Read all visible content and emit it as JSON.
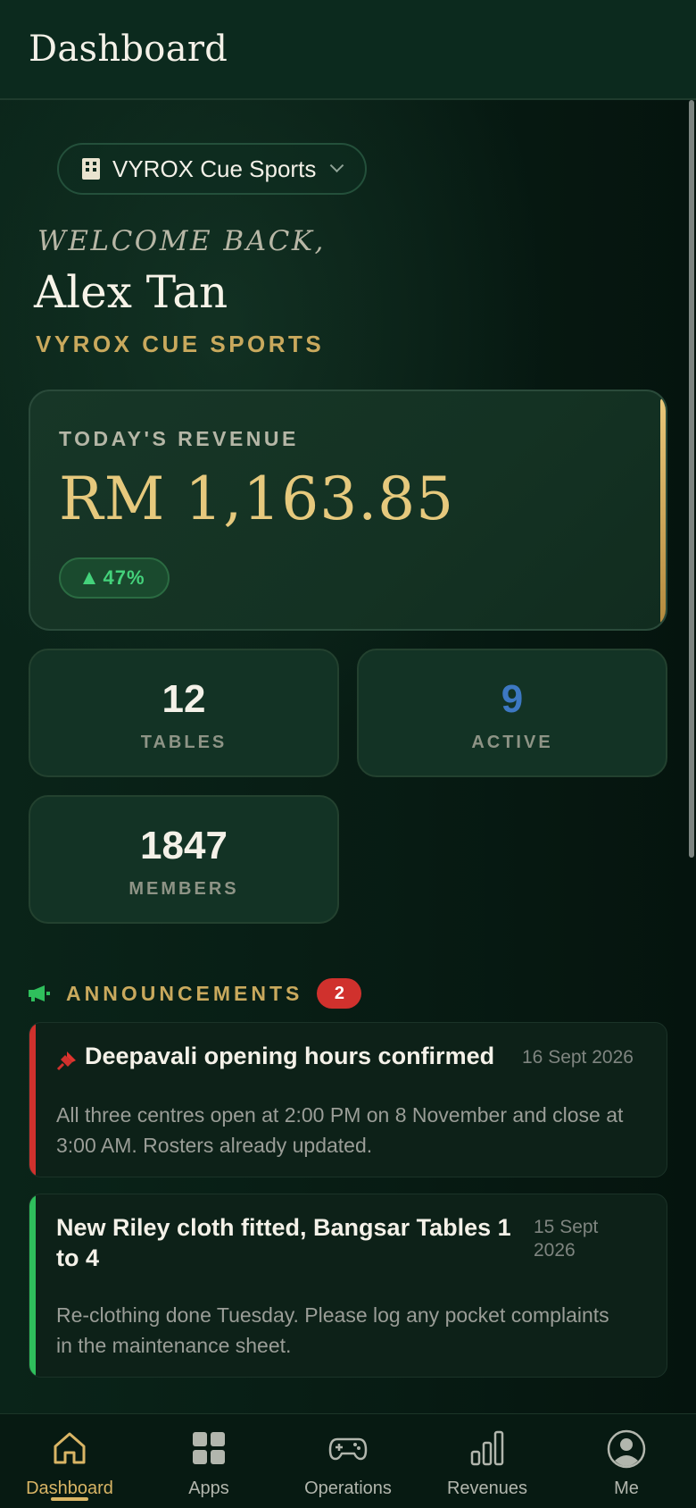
{
  "header": {
    "title": "Dashboard"
  },
  "venue_selector": {
    "value": "VYROX Cue Sports",
    "icon": "building-icon"
  },
  "welcome": {
    "greeting": "WELCOME BACK,",
    "name": "Alex Tan",
    "venue": "VYROX CUE SPORTS"
  },
  "revenue": {
    "label": "TODAY'S REVENUE",
    "value": "RM 1,163.85",
    "delta": "47%",
    "delta_direction": "up",
    "delta_color": "#44d27b"
  },
  "stats": [
    {
      "value": "12",
      "label": "TABLES",
      "color": "#f4f1e8"
    },
    {
      "value": "9",
      "label": "ACTIVE",
      "color": "#3d78c2"
    },
    {
      "value": "1847",
      "label": "MEMBERS",
      "color": "#f4f1e8"
    }
  ],
  "announcements": {
    "title": "ANNOUNCEMENTS",
    "count": "2",
    "items": [
      {
        "title": "Deepavali opening hours confirmed",
        "date": "16 Sept 2026",
        "body": "All three centres open at 2:00 PM on 8 November and close at 3:00 AM. Rosters already updated.",
        "pinned": true,
        "accent": "#d0312d"
      },
      {
        "title": "New Riley cloth fitted, Bangsar Tables 1 to 4",
        "date": "15 Sept 2026",
        "body": "Re-clothing done Tuesday. Please log any pocket complaints in the maintenance sheet.",
        "pinned": false,
        "accent": "#2fbf5c"
      }
    ]
  },
  "nav": {
    "active": "Dashboard",
    "items": [
      {
        "label": "Dashboard",
        "icon": "home-icon"
      },
      {
        "label": "Apps",
        "icon": "apps-grid-icon"
      },
      {
        "label": "Operations",
        "icon": "gamepad-icon"
      },
      {
        "label": "Revenues",
        "icon": "bar-chart-icon"
      },
      {
        "label": "Me",
        "icon": "user-circle-icon"
      }
    ]
  },
  "colors": {
    "background": "#061711",
    "gold": "#c9a95d",
    "card": "#133325"
  }
}
